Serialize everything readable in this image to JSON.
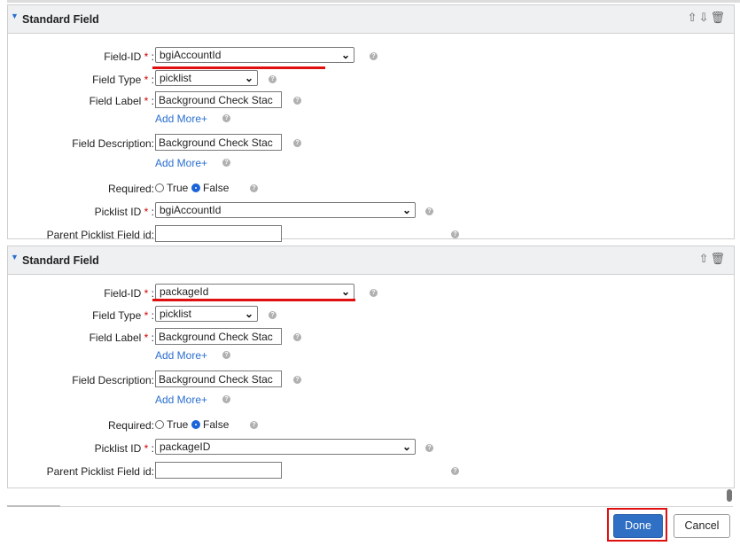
{
  "sections": [
    {
      "title": "Standard Field",
      "header_icons": [
        "move-up-icon",
        "move-down-icon",
        "delete-icon"
      ],
      "field_id": {
        "label": "Field-ID",
        "value": "bgiAccountId"
      },
      "field_type": {
        "label": "Field Type",
        "value": "picklist"
      },
      "field_label": {
        "label": "Field Label",
        "value": "Background Check Stac"
      },
      "add_more_1": "Add More+",
      "field_description": {
        "label": "Field Description:",
        "value": "Background Check Stac"
      },
      "add_more_2": "Add More+",
      "required": {
        "label": "Required:",
        "true_label": "True",
        "false_label": "False",
        "selected": "False"
      },
      "picklist_id": {
        "label": "Picklist ID",
        "value": "bgiAccountId"
      },
      "parent_picklist": {
        "label": "Parent Picklist Field id:",
        "value": ""
      }
    },
    {
      "title": "Standard Field",
      "header_icons": [
        "move-up-icon",
        "delete-icon"
      ],
      "field_id": {
        "label": "Field-ID",
        "value": "packageId"
      },
      "field_type": {
        "label": "Field Type",
        "value": "picklist"
      },
      "field_label": {
        "label": "Field Label",
        "value": "Background Check Stac"
      },
      "add_more_1": "Add More+",
      "field_description": {
        "label": "Field Description:",
        "value": "Background Check Stac"
      },
      "add_more_2": "Add More+",
      "required": {
        "label": "Required:",
        "true_label": "True",
        "false_label": "False",
        "selected": "False"
      },
      "picklist_id": {
        "label": "Picklist ID",
        "value": "packageID"
      },
      "parent_picklist": {
        "label": "Parent Picklist Field id:",
        "value": ""
      }
    }
  ],
  "required_marker": "*",
  "colon": ":",
  "footer": {
    "done_label": "Done",
    "cancel_label": "Cancel"
  },
  "colors": {
    "accent": "#2f6fc4",
    "highlight": "#e01010",
    "required": "#d00000",
    "link": "#2a6fd0"
  }
}
